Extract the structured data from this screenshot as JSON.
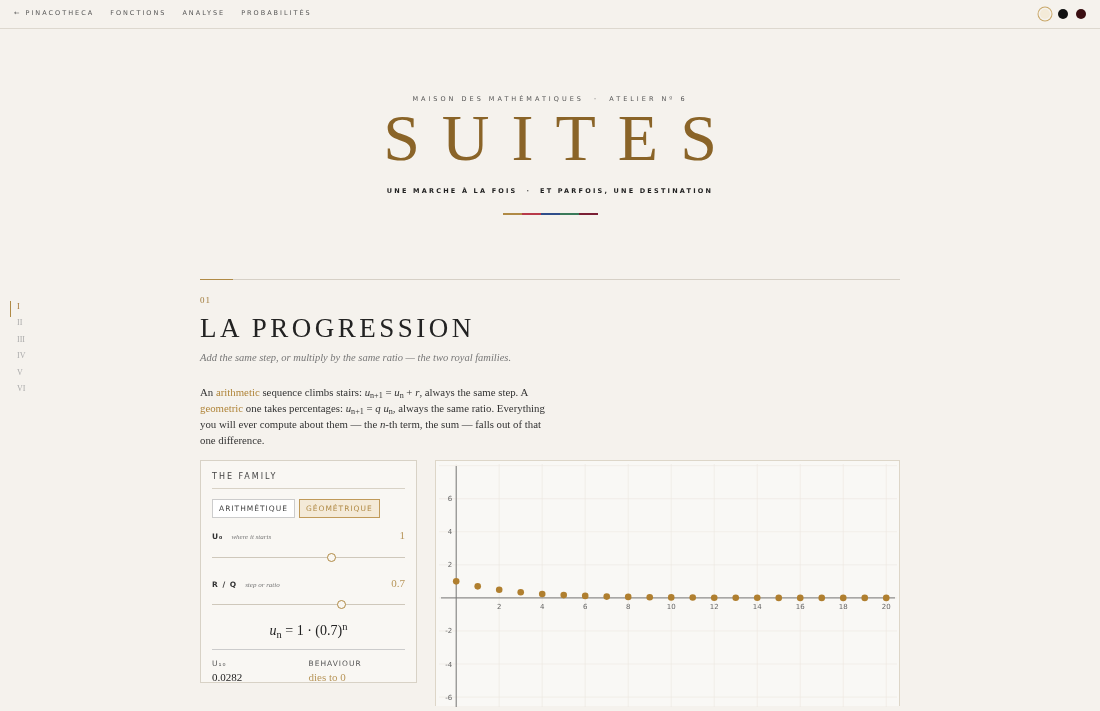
{
  "nav": {
    "links": [
      {
        "label": "← PINACOTHECA"
      },
      {
        "label": "FONCTIONS"
      },
      {
        "label": "ANALYSE"
      },
      {
        "label": "PROBABILITÉS"
      }
    ],
    "themes": [
      {
        "color": "#f3ead8",
        "selected": true
      },
      {
        "color": "#111111",
        "selected": false
      },
      {
        "color": "#3a0e12",
        "selected": false
      }
    ]
  },
  "hero": {
    "overline": "MAISON DES MATHÉMATIQUES  ·  ATELIER Nº 6",
    "title": "SUITES",
    "tagline": "UNE MARCHE À LA FOIS  ·  ET PARFOIS, UNE DESTINATION",
    "ornament": [
      {
        "color": "#b08a45"
      },
      {
        "color": "#b83a4a"
      },
      {
        "color": "#2f4e8a"
      },
      {
        "color": "#3a7a5a"
      },
      {
        "color": "#7a1f34"
      }
    ]
  },
  "side_nav": [
    {
      "label": "I",
      "selected": true
    },
    {
      "label": "II",
      "selected": false
    },
    {
      "label": "III",
      "selected": false
    },
    {
      "label": "IV",
      "selected": false
    },
    {
      "label": "V",
      "selected": false
    },
    {
      "label": "VI",
      "selected": false
    }
  ],
  "section": {
    "number": "01",
    "title": "LA PROGRESSION",
    "subtitle": "Add the same step, or multiply by the same ratio — the two royal families.",
    "body": [
      {
        "kind": "text",
        "text": "An "
      },
      {
        "kind": "term",
        "text": "arithmetic"
      },
      {
        "kind": "text",
        "text": " sequence climbs stairs: *u*$_{n+1}$ = *u*$_{n}$ + *r*, always the same step. A "
      },
      {
        "kind": "term",
        "text": "geometric"
      },
      {
        "kind": "text",
        "text": " one takes percentages: *u*$_{n+1}$ = *q u*$_{n}$, always the same ratio. Everything you will ever compute about them — the *n*-th term, the sum — falls out of that one difference."
      }
    ],
    "panel": {
      "title": "THE FAMILY",
      "tabs": [
        {
          "label": "ARITHMÉTIQUE",
          "selected": false
        },
        {
          "label": "GÉOMÉTRIQUE",
          "selected": true
        }
      ],
      "sliders": [
        {
          "label": "U₀",
          "hint": "where it starts",
          "reading": "1",
          "level": 0.62
        },
        {
          "label": "R / Q",
          "hint": "step or ratio",
          "reading": "0.7",
          "level": 0.67
        }
      ],
      "formula": "*u*$_{n}$ = 1 · (0.7)$^{n}$",
      "stats": [
        {
          "label": "U₁₀",
          "value": "0.0282",
          "kind": "plain"
        },
        {
          "label": "BEHAVIOUR",
          "value": "dies to 0",
          "kind": "accent"
        }
      ]
    },
    "chart_data": {
      "type": "scatter",
      "x": [
        0,
        1,
        2,
        3,
        4,
        5,
        6,
        7,
        8,
        9,
        10,
        11,
        12,
        13,
        14,
        15,
        16,
        17,
        18,
        19,
        20
      ],
      "grid": true,
      "series": [
        {
          "color": "#b07f2f",
          "values": [
            1,
            0.7,
            0.49,
            0.34,
            0.24,
            0.17,
            0.12,
            0.08,
            0.06,
            0.04,
            0.03,
            0.02,
            0.01,
            0.01,
            0.01,
            0,
            0,
            0,
            0,
            0,
            0
          ]
        }
      ],
      "xlim": [
        -0.8,
        20.5
      ],
      "ylim": [
        -6.6,
        8.1
      ],
      "xticks": [
        2,
        4,
        6,
        8,
        10,
        12,
        14,
        16,
        18,
        20
      ],
      "yticks": [
        -6,
        -4,
        -2,
        2,
        4,
        6
      ]
    }
  }
}
